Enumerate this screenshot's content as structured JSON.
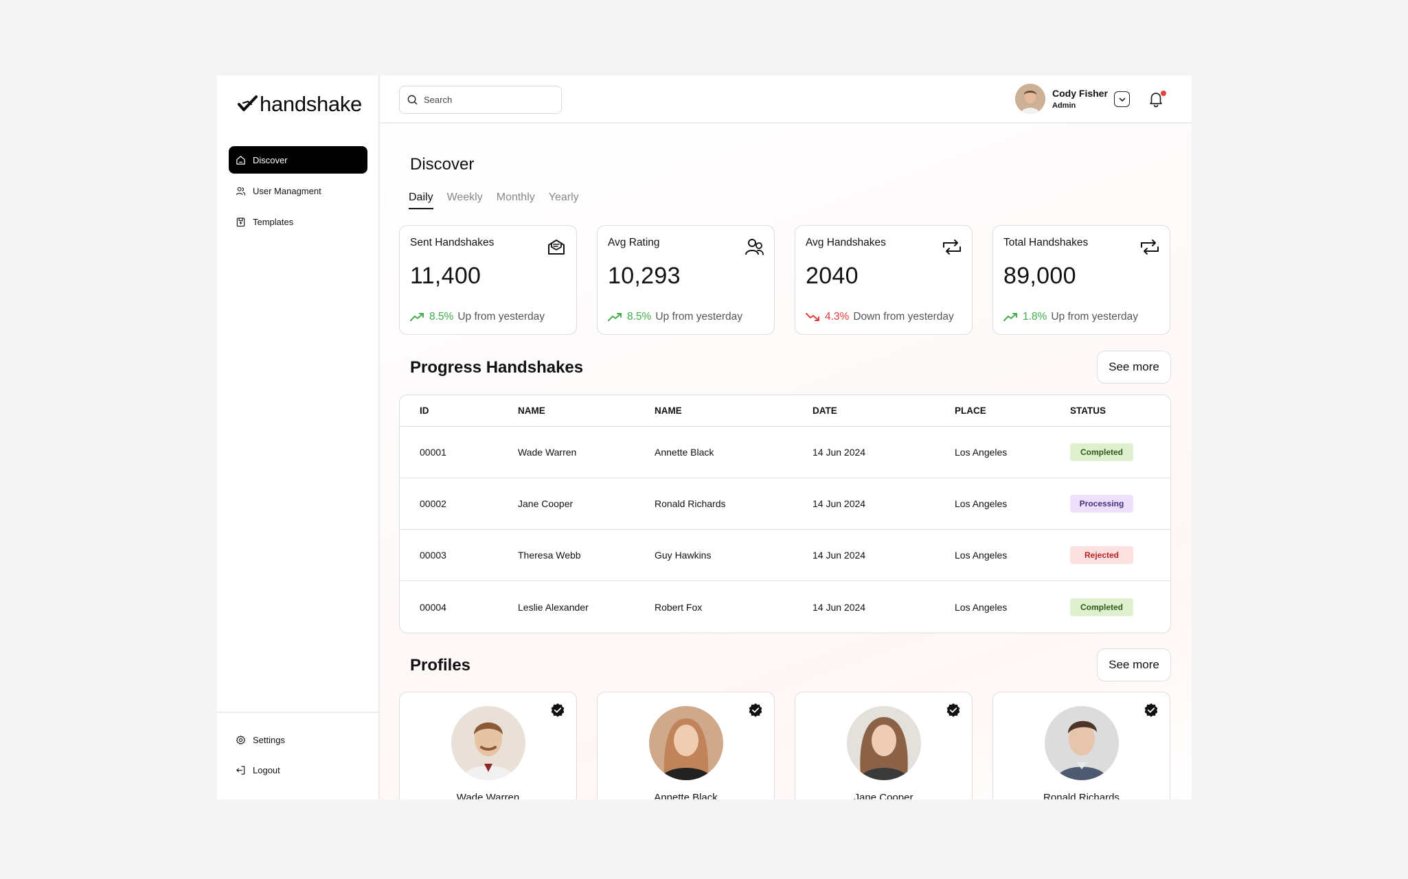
{
  "brand": {
    "name": "handshake"
  },
  "sidebar": {
    "items": [
      {
        "label": "Discover",
        "icon": "home-icon",
        "active": true
      },
      {
        "label": "User Managment",
        "icon": "users-icon",
        "active": false
      },
      {
        "label": "Templates",
        "icon": "template-icon",
        "active": false
      }
    ],
    "bottom": [
      {
        "label": "Settings",
        "icon": "gear-icon"
      },
      {
        "label": "Logout",
        "icon": "logout-icon"
      }
    ]
  },
  "header": {
    "search_placeholder": "Search",
    "user": {
      "name": "Cody Fisher",
      "role": "Admin"
    }
  },
  "page": {
    "title": "Discover",
    "tabs": [
      "Daily",
      "Weekly",
      "Monthly",
      "Yearly"
    ],
    "active_tab": "Daily"
  },
  "stats": [
    {
      "label": "Sent Handshakes",
      "value": "11,400",
      "change": "8.5%",
      "direction": "up",
      "note": "Up from yesterday",
      "icon": "envelope-icon"
    },
    {
      "label": "Avg Rating",
      "value": "10,293",
      "change": "8.5%",
      "direction": "up",
      "note": "Up from yesterday",
      "icon": "users-icon"
    },
    {
      "label": "Avg Handshakes",
      "value": "2040",
      "change": "4.3%",
      "direction": "down",
      "note": "Down from yesterday",
      "icon": "handshake-icon"
    },
    {
      "label": "Total Handshakes",
      "value": "89,000",
      "change": "1.8%",
      "direction": "up",
      "note": "Up from yesterday",
      "icon": "handshake-icon"
    }
  ],
  "progress": {
    "title": "Progress Handshakes",
    "see_more": "See more",
    "columns": [
      "ID",
      "NAME",
      "NAME",
      "DATE",
      "PLACE",
      "STATUS"
    ],
    "rows": [
      {
        "id": "00001",
        "name1": "Wade Warren",
        "name2": "Annette Black",
        "date": "14 Jun 2024",
        "place": "Los Angeles",
        "status": "Completed"
      },
      {
        "id": "00002",
        "name1": "Jane Cooper",
        "name2": "Ronald Richards",
        "date": "14 Jun 2024",
        "place": "Los Angeles",
        "status": "Processing"
      },
      {
        "id": "00003",
        "name1": "Theresa Webb",
        "name2": "Guy Hawkins",
        "date": "14 Jun 2024",
        "place": "Los Angeles",
        "status": "Rejected"
      },
      {
        "id": "00004",
        "name1": "Leslie Alexander",
        "name2": "Robert Fox",
        "date": "14 Jun 2024",
        "place": "Los Angeles",
        "status": "Completed"
      }
    ]
  },
  "profiles": {
    "title": "Profiles",
    "see_more": "See more",
    "items": [
      {
        "name": "Wade Warren",
        "skin": "#e6c3a3",
        "hair": "#8a5a36",
        "shirt": "#f1f1f1"
      },
      {
        "name": "Annette Black",
        "skin": "#f0cdb0",
        "hair": "#c0835a",
        "shirt": "#222222"
      },
      {
        "name": "Jane Cooper",
        "skin": "#efcdb4",
        "hair": "#8b6246",
        "shirt": "#3a3a3a"
      },
      {
        "name": "Ronald Richards",
        "skin": "#e7c5ac",
        "hair": "#4b3526",
        "shirt": "#4d5a70"
      }
    ]
  },
  "colors": {
    "accent": "#000000",
    "up": "#3dae4a",
    "down": "#e23b3b"
  }
}
